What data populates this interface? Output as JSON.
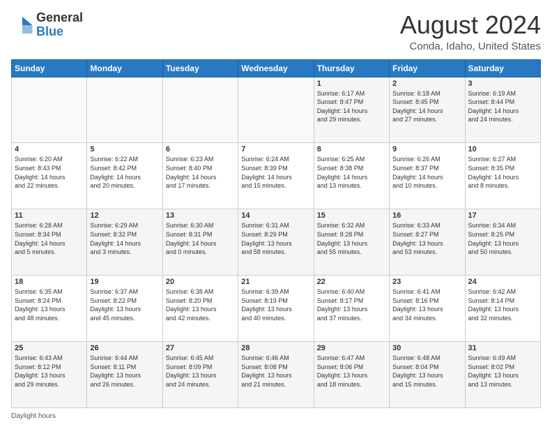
{
  "header": {
    "logo": {
      "general": "General",
      "blue": "Blue"
    },
    "title": "August 2024",
    "subtitle": "Conda, Idaho, United States"
  },
  "calendar": {
    "weekdays": [
      "Sunday",
      "Monday",
      "Tuesday",
      "Wednesday",
      "Thursday",
      "Friday",
      "Saturday"
    ],
    "weeks": [
      [
        {
          "day": "",
          "info": ""
        },
        {
          "day": "",
          "info": ""
        },
        {
          "day": "",
          "info": ""
        },
        {
          "day": "",
          "info": ""
        },
        {
          "day": "1",
          "info": "Sunrise: 6:17 AM\nSunset: 8:47 PM\nDaylight: 14 hours\nand 29 minutes."
        },
        {
          "day": "2",
          "info": "Sunrise: 6:18 AM\nSunset: 8:45 PM\nDaylight: 14 hours\nand 27 minutes."
        },
        {
          "day": "3",
          "info": "Sunrise: 6:19 AM\nSunset: 8:44 PM\nDaylight: 14 hours\nand 24 minutes."
        }
      ],
      [
        {
          "day": "4",
          "info": "Sunrise: 6:20 AM\nSunset: 8:43 PM\nDaylight: 14 hours\nand 22 minutes."
        },
        {
          "day": "5",
          "info": "Sunrise: 6:22 AM\nSunset: 8:42 PM\nDaylight: 14 hours\nand 20 minutes."
        },
        {
          "day": "6",
          "info": "Sunrise: 6:23 AM\nSunset: 8:40 PM\nDaylight: 14 hours\nand 17 minutes."
        },
        {
          "day": "7",
          "info": "Sunrise: 6:24 AM\nSunset: 8:39 PM\nDaylight: 14 hours\nand 15 minutes."
        },
        {
          "day": "8",
          "info": "Sunrise: 6:25 AM\nSunset: 8:38 PM\nDaylight: 14 hours\nand 13 minutes."
        },
        {
          "day": "9",
          "info": "Sunrise: 6:26 AM\nSunset: 8:37 PM\nDaylight: 14 hours\nand 10 minutes."
        },
        {
          "day": "10",
          "info": "Sunrise: 6:27 AM\nSunset: 8:35 PM\nDaylight: 14 hours\nand 8 minutes."
        }
      ],
      [
        {
          "day": "11",
          "info": "Sunrise: 6:28 AM\nSunset: 8:34 PM\nDaylight: 14 hours\nand 5 minutes."
        },
        {
          "day": "12",
          "info": "Sunrise: 6:29 AM\nSunset: 8:32 PM\nDaylight: 14 hours\nand 3 minutes."
        },
        {
          "day": "13",
          "info": "Sunrise: 6:30 AM\nSunset: 8:31 PM\nDaylight: 14 hours\nand 0 minutes."
        },
        {
          "day": "14",
          "info": "Sunrise: 6:31 AM\nSunset: 8:29 PM\nDaylight: 13 hours\nand 58 minutes."
        },
        {
          "day": "15",
          "info": "Sunrise: 6:32 AM\nSunset: 8:28 PM\nDaylight: 13 hours\nand 55 minutes."
        },
        {
          "day": "16",
          "info": "Sunrise: 6:33 AM\nSunset: 8:27 PM\nDaylight: 13 hours\nand 53 minutes."
        },
        {
          "day": "17",
          "info": "Sunrise: 6:34 AM\nSunset: 8:25 PM\nDaylight: 13 hours\nand 50 minutes."
        }
      ],
      [
        {
          "day": "18",
          "info": "Sunrise: 6:35 AM\nSunset: 8:24 PM\nDaylight: 13 hours\nand 48 minutes."
        },
        {
          "day": "19",
          "info": "Sunrise: 6:37 AM\nSunset: 8:22 PM\nDaylight: 13 hours\nand 45 minutes."
        },
        {
          "day": "20",
          "info": "Sunrise: 6:38 AM\nSunset: 8:20 PM\nDaylight: 13 hours\nand 42 minutes."
        },
        {
          "day": "21",
          "info": "Sunrise: 6:39 AM\nSunset: 8:19 PM\nDaylight: 13 hours\nand 40 minutes."
        },
        {
          "day": "22",
          "info": "Sunrise: 6:40 AM\nSunset: 8:17 PM\nDaylight: 13 hours\nand 37 minutes."
        },
        {
          "day": "23",
          "info": "Sunrise: 6:41 AM\nSunset: 8:16 PM\nDaylight: 13 hours\nand 34 minutes."
        },
        {
          "day": "24",
          "info": "Sunrise: 6:42 AM\nSunset: 8:14 PM\nDaylight: 13 hours\nand 32 minutes."
        }
      ],
      [
        {
          "day": "25",
          "info": "Sunrise: 6:43 AM\nSunset: 8:12 PM\nDaylight: 13 hours\nand 29 minutes."
        },
        {
          "day": "26",
          "info": "Sunrise: 6:44 AM\nSunset: 8:11 PM\nDaylight: 13 hours\nand 26 minutes."
        },
        {
          "day": "27",
          "info": "Sunrise: 6:45 AM\nSunset: 8:09 PM\nDaylight: 13 hours\nand 24 minutes."
        },
        {
          "day": "28",
          "info": "Sunrise: 6:46 AM\nSunset: 8:08 PM\nDaylight: 13 hours\nand 21 minutes."
        },
        {
          "day": "29",
          "info": "Sunrise: 6:47 AM\nSunset: 8:06 PM\nDaylight: 13 hours\nand 18 minutes."
        },
        {
          "day": "30",
          "info": "Sunrise: 6:48 AM\nSunset: 8:04 PM\nDaylight: 13 hours\nand 15 minutes."
        },
        {
          "day": "31",
          "info": "Sunrise: 6:49 AM\nSunset: 8:02 PM\nDaylight: 13 hours\nand 13 minutes."
        }
      ]
    ]
  },
  "footer": {
    "text": "Daylight hours"
  }
}
